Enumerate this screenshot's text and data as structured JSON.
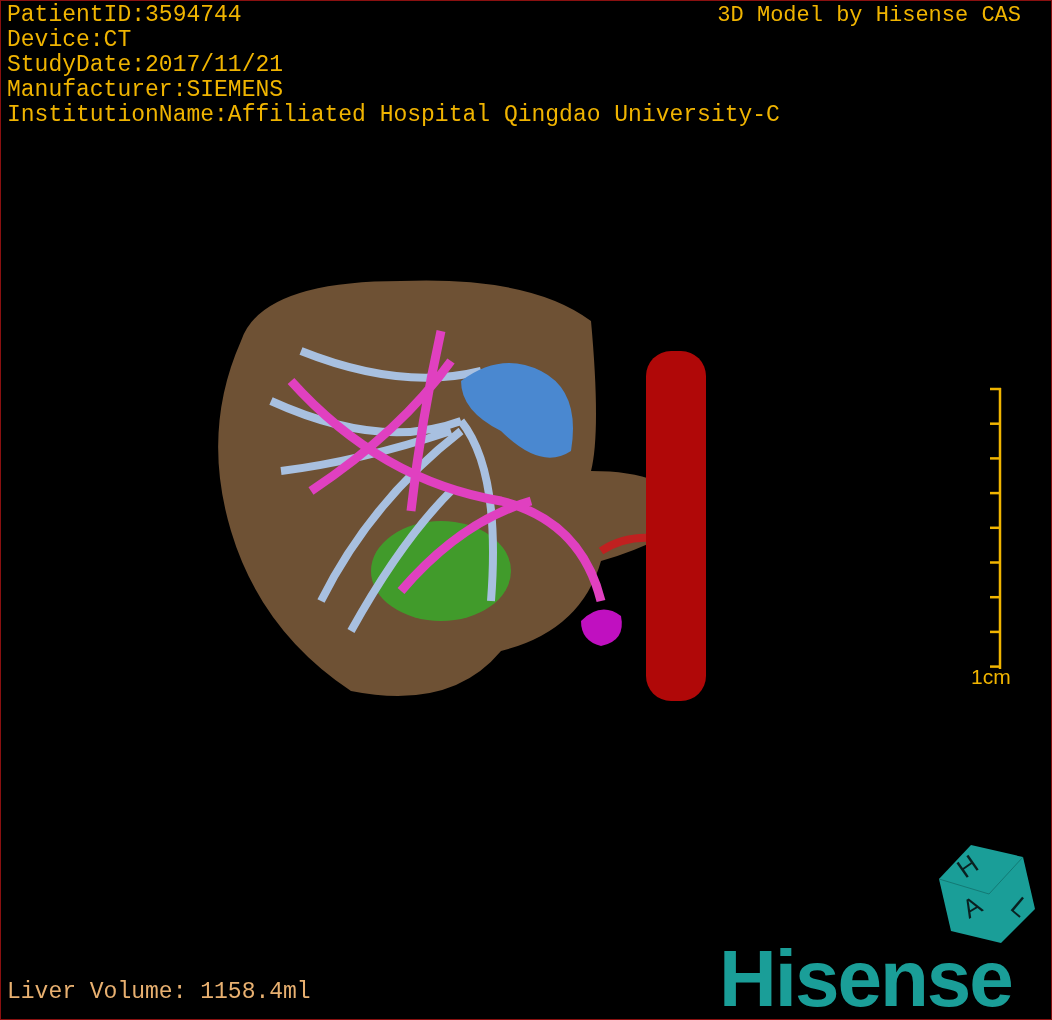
{
  "header_lines": [
    {
      "text": "PatientID:3594744"
    },
    {
      "text": "Device:CT"
    },
    {
      "text": "StudyDate:2017/11/21"
    },
    {
      "text": "Manufacturer:SIEMENS"
    },
    {
      "text": "InstitutionName:Affiliated Hospital Qingdao University-C"
    }
  ],
  "credit": "3D Model by Hisense CAS",
  "scale": {
    "label": "1cm"
  },
  "orientation_cube": {
    "labels": [
      "H",
      "A",
      "L"
    ]
  },
  "logo": "Hisense",
  "measurement": "Liver Volume: 1158.4ml"
}
